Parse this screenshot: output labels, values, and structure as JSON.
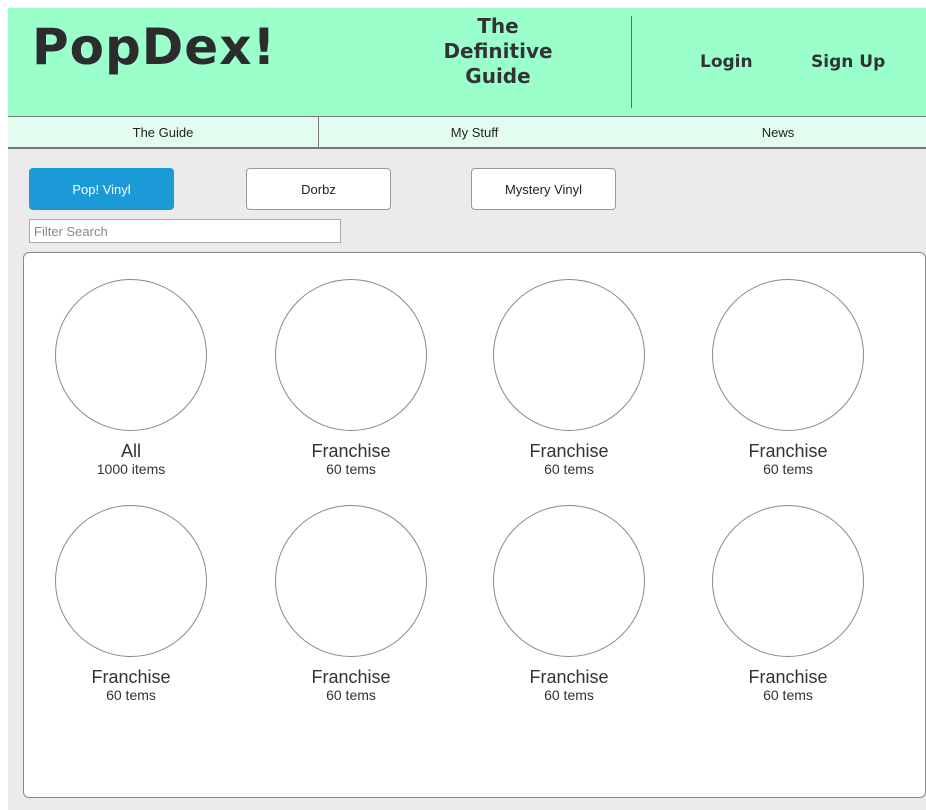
{
  "header": {
    "logo": "PopDex!",
    "tagline": [
      "The",
      "Definitive",
      "Guide"
    ],
    "login_label": "Login",
    "signup_label": "Sign Up",
    "background": "#9bffcc"
  },
  "nav": {
    "items": [
      {
        "label": "The Guide"
      },
      {
        "label": "My Stuff"
      },
      {
        "label": "News"
      }
    ],
    "background": "#e3fcf0"
  },
  "type_tabs": {
    "items": [
      {
        "label": "Pop! Vinyl",
        "active": true
      },
      {
        "label": "Dorbz",
        "active": false
      },
      {
        "label": "Mystery Vinyl",
        "active": false
      }
    ],
    "active_color": "#1b9ad7"
  },
  "filter": {
    "placeholder": "Filter Search",
    "value": ""
  },
  "categories": [
    {
      "name": "All",
      "count": "1000 items"
    },
    {
      "name": "Franchise",
      "count": "60 tems"
    },
    {
      "name": "Franchise",
      "count": "60 tems"
    },
    {
      "name": "Franchise",
      "count": "60 tems"
    },
    {
      "name": "Franchise",
      "count": "60 tems"
    },
    {
      "name": "Franchise",
      "count": "60 tems"
    },
    {
      "name": "Franchise",
      "count": "60 tems"
    },
    {
      "name": "Franchise",
      "count": "60 tems"
    }
  ]
}
